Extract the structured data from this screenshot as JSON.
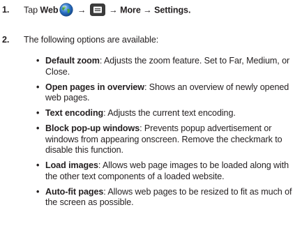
{
  "steps": [
    {
      "number": "1.",
      "prefix": "Tap ",
      "web": "Web",
      "arrow1": " → ",
      "arrow2": " → ",
      "more": "More",
      "arrow3": " → ",
      "settings": "Settings",
      "period": ".",
      "icons": [
        "web-globe-icon",
        "menu-key-icon"
      ]
    },
    {
      "number": "2.",
      "text": "The following options are available:"
    }
  ],
  "bullet_glyph": "•",
  "options": [
    {
      "name": "Default zoom",
      "description": ": Adjusts the zoom feature. Set to Far, Medium, or Close."
    },
    {
      "name": "Open pages in overview",
      "description": ": Shows an overview of newly opened web pages."
    },
    {
      "name": "Text encoding",
      "description": ": Adjusts the current text encoding."
    },
    {
      "name": "Block pop-up windows",
      "description": ": Prevents popup advertisement or windows from appearing onscreen. Remove the checkmark to disable this function."
    },
    {
      "name": "Load images",
      "description": ": Allows web page images to be loaded along with the other text components of a loaded website."
    },
    {
      "name": "Auto-fit pages",
      "description": ": Allows web pages to be resized to fit as much of the screen as possible."
    }
  ],
  "colors": {
    "text": "#231f20",
    "globe_blue": "#2a6fc4",
    "globe_green": "#4aa43c",
    "menu_key_bg": "#3b3b3b"
  }
}
